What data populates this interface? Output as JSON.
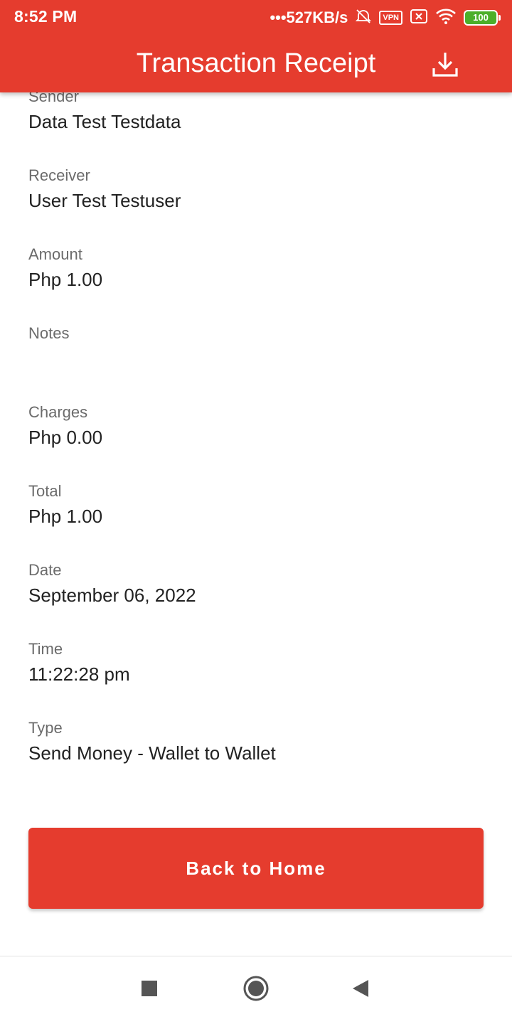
{
  "status_bar": {
    "time": "8:52 PM",
    "net_speed": "•••527KB/s",
    "vpn_label": "VPN",
    "battery_level": "100",
    "battery_color": "#4caf2a"
  },
  "header": {
    "title": "Transaction Receipt",
    "background_color": "#e53c2e",
    "download_icon": "download-icon"
  },
  "receipt": {
    "fields": [
      {
        "label": "Sender",
        "value": "Data Test Testdata"
      },
      {
        "label": "Receiver",
        "value": "User Test Testuser"
      },
      {
        "label": "Amount",
        "value": "Php 1.00"
      },
      {
        "label": "Notes",
        "value": ""
      },
      {
        "label": "Charges",
        "value": "Php 0.00"
      },
      {
        "label": "Total",
        "value": "Php 1.00"
      },
      {
        "label": "Date",
        "value": "September 06, 2022"
      },
      {
        "label": "Time",
        "value": "11:22:28 pm"
      },
      {
        "label": "Type",
        "value": "Send Money - Wallet to Wallet"
      }
    ]
  },
  "actions": {
    "back_label": "Back to Home"
  },
  "navigation": {
    "recents_icon": "square-icon",
    "home_icon": "circle-icon",
    "back_icon": "triangle-back-icon"
  }
}
